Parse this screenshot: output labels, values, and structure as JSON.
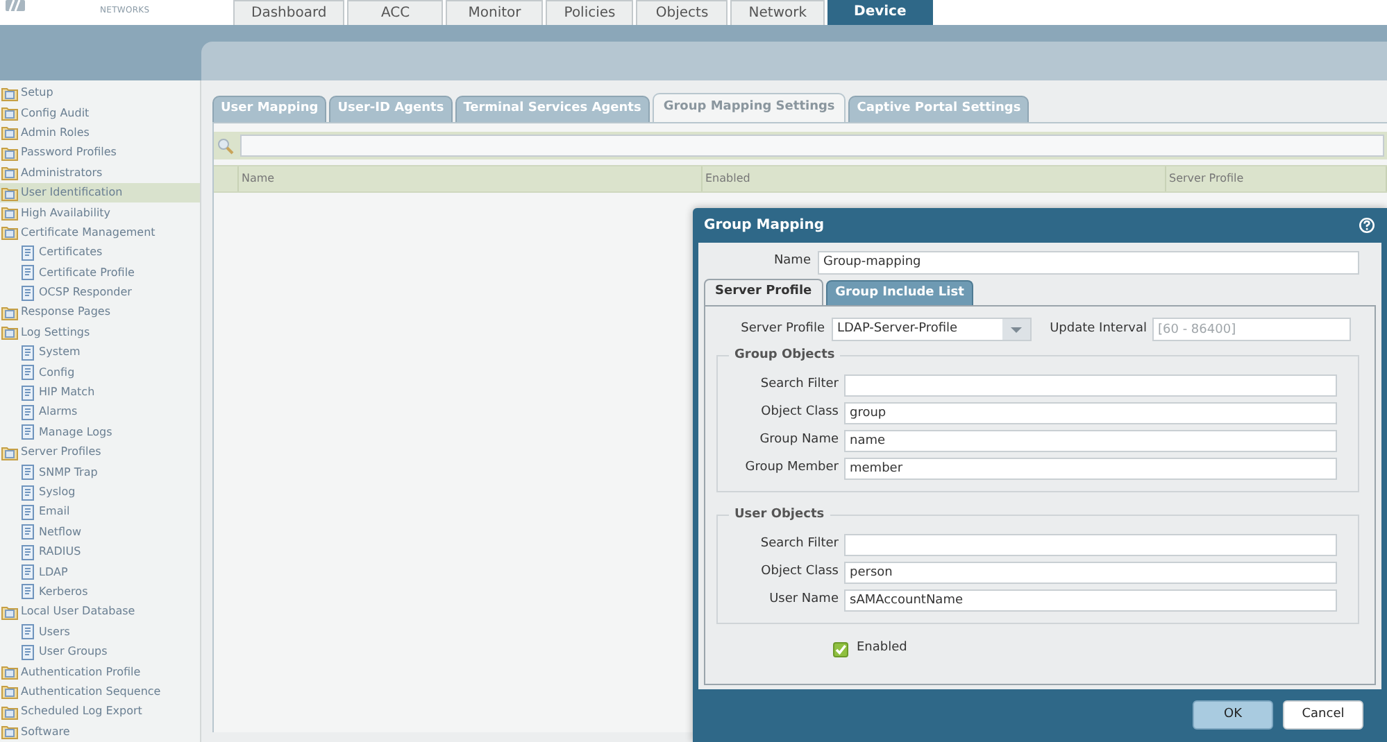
{
  "logo": {
    "subtitle": "NETWORKS"
  },
  "main_tabs": [
    {
      "label": "Dashboard",
      "selected": false
    },
    {
      "label": "ACC",
      "selected": false
    },
    {
      "label": "Monitor",
      "selected": false
    },
    {
      "label": "Policies",
      "selected": false
    },
    {
      "label": "Objects",
      "selected": false
    },
    {
      "label": "Network",
      "selected": false
    },
    {
      "label": "Device",
      "selected": true
    }
  ],
  "sidebar": {
    "items": [
      {
        "label": "Setup",
        "selected": false
      },
      {
        "label": "Config Audit",
        "selected": false
      },
      {
        "label": "Admin Roles",
        "selected": false
      },
      {
        "label": "Password Profiles",
        "selected": false
      },
      {
        "label": "Administrators",
        "selected": false
      },
      {
        "label": "User Identification",
        "selected": true
      },
      {
        "label": "High Availability",
        "selected": false
      },
      {
        "label": "Certificate Management",
        "selected": false,
        "children": [
          {
            "label": "Certificates",
            "selected": false
          },
          {
            "label": "Certificate Profile",
            "selected": false
          },
          {
            "label": "OCSP Responder",
            "selected": false
          }
        ]
      },
      {
        "label": "Response Pages",
        "selected": false
      },
      {
        "label": "Log Settings",
        "selected": false,
        "children": [
          {
            "label": "System",
            "selected": false
          },
          {
            "label": "Config",
            "selected": false
          },
          {
            "label": "HIP Match",
            "selected": false
          },
          {
            "label": "Alarms",
            "selected": false
          },
          {
            "label": "Manage Logs",
            "selected": false
          }
        ]
      },
      {
        "label": "Server Profiles",
        "selected": false,
        "children": [
          {
            "label": "SNMP Trap",
            "selected": false
          },
          {
            "label": "Syslog",
            "selected": false
          },
          {
            "label": "Email",
            "selected": false
          },
          {
            "label": "Netflow",
            "selected": false
          },
          {
            "label": "RADIUS",
            "selected": false
          },
          {
            "label": "LDAP",
            "selected": false
          },
          {
            "label": "Kerberos",
            "selected": false
          }
        ]
      },
      {
        "label": "Local User Database",
        "selected": false,
        "children": [
          {
            "label": "Users",
            "selected": false
          },
          {
            "label": "User Groups",
            "selected": false
          }
        ]
      },
      {
        "label": "Authentication Profile",
        "selected": false
      },
      {
        "label": "Authentication Sequence",
        "selected": false
      },
      {
        "label": "Scheduled Log Export",
        "selected": false
      },
      {
        "label": "Software",
        "selected": false
      }
    ]
  },
  "sub_tabs": [
    {
      "label": "User Mapping",
      "selected": false
    },
    {
      "label": "User-ID Agents",
      "selected": false
    },
    {
      "label": "Terminal Services Agents",
      "selected": false
    },
    {
      "label": "Group Mapping Settings",
      "selected": true
    },
    {
      "label": "Captive Portal Settings",
      "selected": false
    }
  ],
  "table": {
    "columns": [
      "Name",
      "Enabled",
      "Server Profile"
    ]
  },
  "dialog": {
    "title": "Group Mapping",
    "name_label": "Name",
    "name_value": "Group-mapping",
    "tabs": [
      {
        "label": "Server Profile",
        "selected": true
      },
      {
        "label": "Group Include List",
        "selected": false
      }
    ],
    "server_profile_label": "Server Profile",
    "server_profile_value": "LDAP-Server-Profile",
    "update_interval_label": "Update Interval",
    "update_interval_placeholder": "[60 - 86400]",
    "groups": [
      {
        "title": "Group Objects",
        "fields": [
          {
            "label": "Search Filter"
          },
          {
            "label": "Object Class",
            "value": "group"
          },
          {
            "label": "Group Name",
            "value": "name"
          },
          {
            "label": "Group Member",
            "value": "member"
          }
        ]
      },
      {
        "title": "User Objects",
        "fields": [
          {
            "label": "Search Filter"
          },
          {
            "label": "Object Class",
            "value": "person"
          },
          {
            "label": "User Name",
            "value": "sAMAccountName"
          }
        ]
      }
    ],
    "enabled": {
      "label": "Enabled",
      "checked": true
    },
    "buttons": [
      {
        "label": "OK",
        "kind": "primary"
      },
      {
        "label": "Cancel",
        "kind": "secondary"
      }
    ]
  }
}
